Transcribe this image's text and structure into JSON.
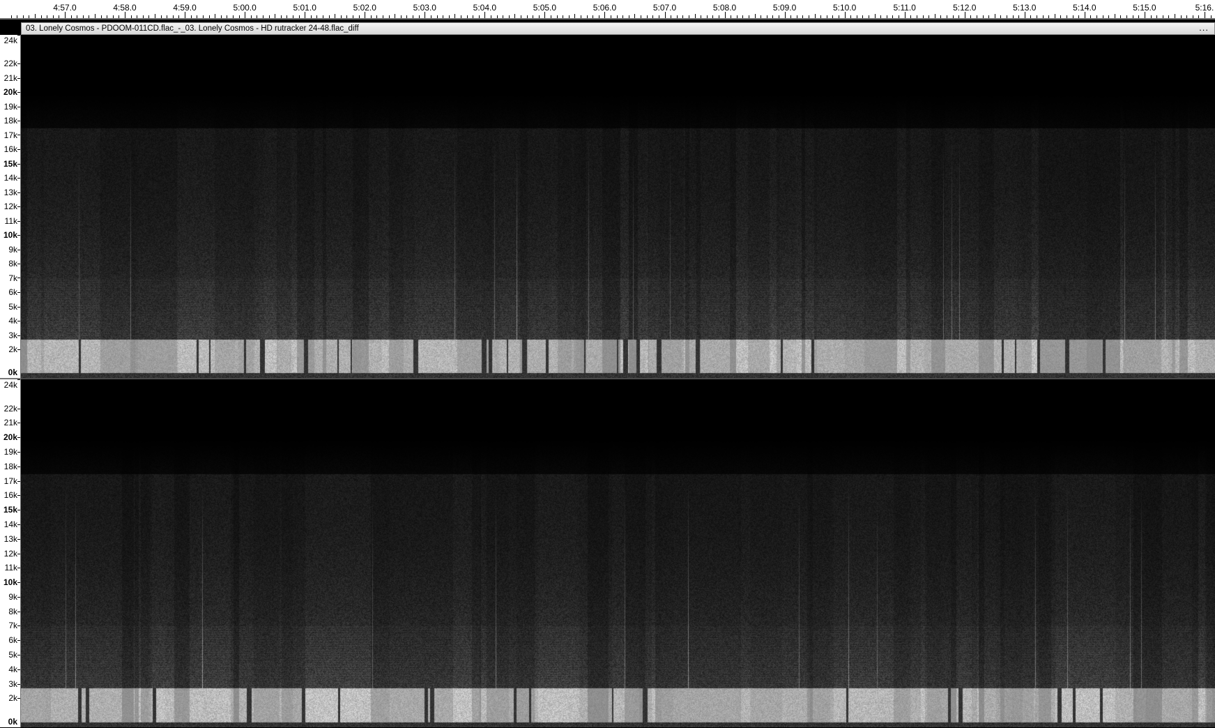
{
  "ruler": {
    "labels": [
      "4:57.0",
      "4:58.0",
      "4:59.0",
      "5:00.0",
      "5:01.0",
      "5:02.0",
      "5:03.0",
      "5:04.0",
      "5:05.0",
      "5:06.0",
      "5:07.0",
      "5:08.0",
      "5:09.0",
      "5:10.0",
      "5:11.0",
      "5:12.0",
      "5:13.0",
      "5:14.0",
      "5:15.0",
      "5:16."
    ]
  },
  "track": {
    "name": "03. Lonely Cosmos - PDOOM-011CD.flac_-_03. Lonely Cosmos - HD rutracker 24-48.flac_diff",
    "menu_label": "..."
  },
  "scale": {
    "labels": [
      "24k",
      "22k",
      "21k",
      "20k",
      "19k",
      "18k",
      "17k",
      "16k",
      "15k",
      "14k",
      "13k",
      "12k",
      "11k",
      "10k",
      "9k",
      "8k",
      "7k",
      "6k",
      "5k",
      "4k",
      "3k",
      "2k",
      "0k"
    ],
    "bold": [
      "20k",
      "15k",
      "10k",
      "0k"
    ]
  },
  "channels": [
    {
      "name": "channel-1"
    },
    {
      "name": "channel-2"
    }
  ],
  "colors": {
    "background": "#000000",
    "ruler": "#ffffff",
    "header": "#e6e6e6"
  }
}
